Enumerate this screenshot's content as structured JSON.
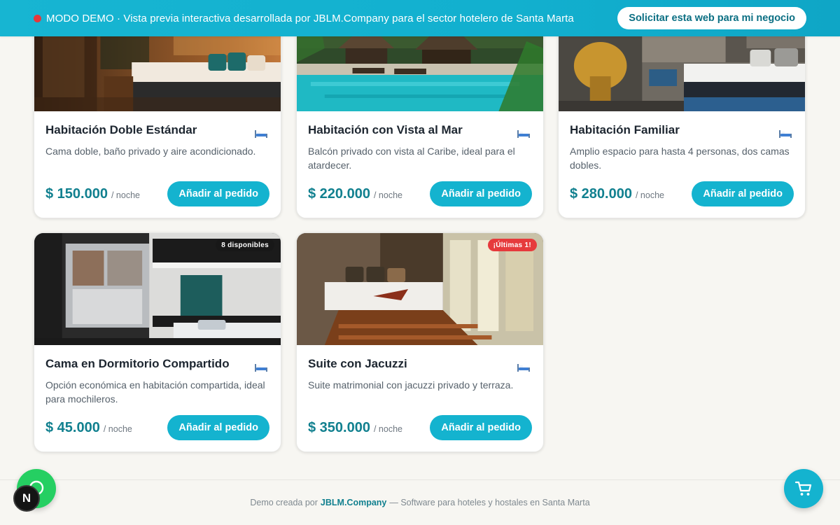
{
  "banner": {
    "text": "MODO DEMO · Vista previa interactiva desarrollada por JBLM.Company para el sector hotelero de Santa Marta",
    "cta_label": "Solicitar esta web para mi negocio"
  },
  "rooms": [
    {
      "title": "Habitación Doble Estándar",
      "description": "Cama doble, baño privado y aire acondicionado.",
      "price": "$ 150.000",
      "price_unit": "/ noche",
      "button_label": "Añadir al pedido"
    },
    {
      "title": "Habitación con Vista al Mar",
      "description": "Balcón privado con vista al Caribe, ideal para el atardecer.",
      "price": "$ 220.000",
      "price_unit": "/ noche",
      "button_label": "Añadir al pedido"
    },
    {
      "title": "Habitación Familiar",
      "description": "Amplio espacio para hasta 4 personas, dos camas dobles.",
      "price": "$ 280.000",
      "price_unit": "/ noche",
      "button_label": "Añadir al pedido"
    },
    {
      "title": "Cama en Dormitorio Compartido",
      "description": "Opción económica en habitación compartida, ideal para mochileros.",
      "price": "$ 45.000",
      "price_unit": "/ noche",
      "button_label": "Añadir al pedido",
      "badge": "8 disponibles"
    },
    {
      "title": "Suite con Jacuzzi",
      "description": "Suite matrimonial con jacuzzi privado y terraza.",
      "price": "$ 350.000",
      "price_unit": "/ noche",
      "button_label": "Añadir al pedido",
      "badge": "¡Últimas 1!"
    }
  ],
  "footer": {
    "prefix": "Demo creada por",
    "brand": "JBLM.Company",
    "suffix": "— Software para hoteles y hostales en Santa Marta"
  },
  "floating": {
    "avatar_letter": "N"
  },
  "colors": {
    "accent": "#14b3cf",
    "price": "#11808f",
    "demo_dot": "#e5383b",
    "whatsapp": "#25cf62",
    "badge_last": "#e63a3c"
  },
  "icons": [
    "bed-icon",
    "whatsapp-icon",
    "cart-icon"
  ]
}
